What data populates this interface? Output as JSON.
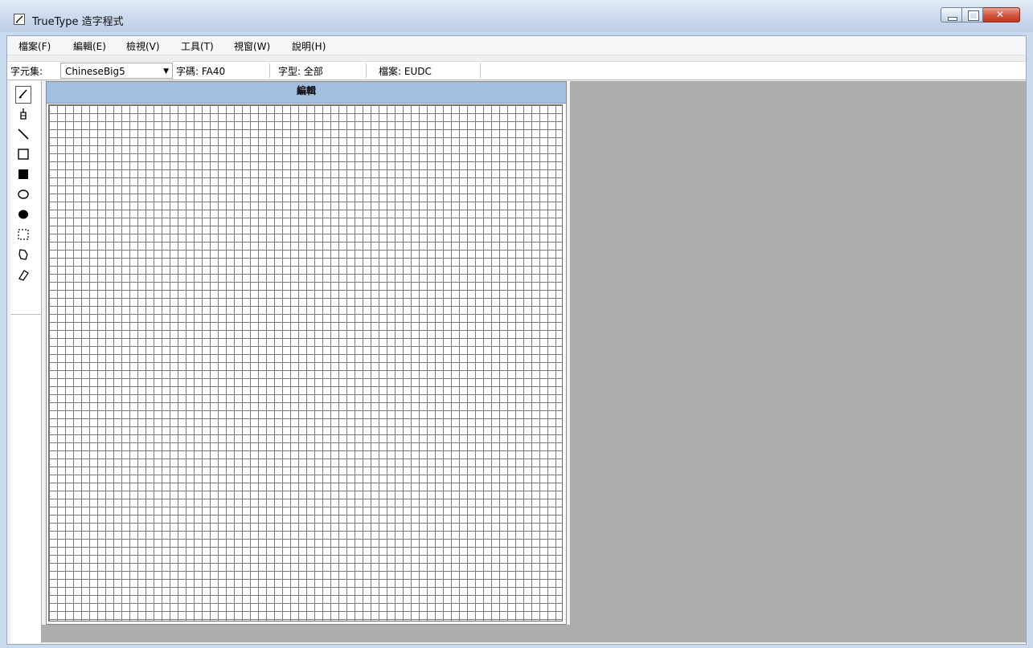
{
  "window": {
    "title": "TrueType 造字程式",
    "icon": "pencil-edit-icon",
    "controls": [
      "minimize-icon",
      "maximize-icon",
      "close-icon"
    ]
  },
  "menu": [
    {
      "label": "檔案(F)"
    },
    {
      "label": "編輯(E)"
    },
    {
      "label": "檢視(V)"
    },
    {
      "label": "工具(T)"
    },
    {
      "label": "視窗(W)"
    },
    {
      "label": "說明(H)"
    }
  ],
  "toolbar": {
    "charset_label": "字元集:",
    "charset_value": "ChineseBig5",
    "code_label": "字碼: FA40",
    "font_label": "字型: 全部",
    "file_label": "檔案: EUDC"
  },
  "tools": [
    {
      "name": "pencil-tool",
      "icon": "pencil-icon",
      "selected": true
    },
    {
      "name": "brush-tool",
      "icon": "brush-icon"
    },
    {
      "name": "line-tool",
      "icon": "line-icon"
    },
    {
      "name": "hollow-rectangle-tool",
      "icon": "hollow-rectangle-icon"
    },
    {
      "name": "filled-rectangle-tool",
      "icon": "filled-rectangle-icon"
    },
    {
      "name": "hollow-ellipse-tool",
      "icon": "hollow-ellipse-icon"
    },
    {
      "name": "filled-ellipse-tool",
      "icon": "filled-ellipse-icon"
    },
    {
      "name": "rectangle-select-tool",
      "icon": "rectangle-select-icon"
    },
    {
      "name": "freeform-select-tool",
      "icon": "freeform-select-icon"
    },
    {
      "name": "eraser-tool",
      "icon": "eraser-icon"
    }
  ],
  "editor": {
    "header": "編輯"
  },
  "colors": {
    "header_bg": "#a3bfe0",
    "workspace_gray": "#adadad",
    "grid_line": "#7b7b7b"
  }
}
